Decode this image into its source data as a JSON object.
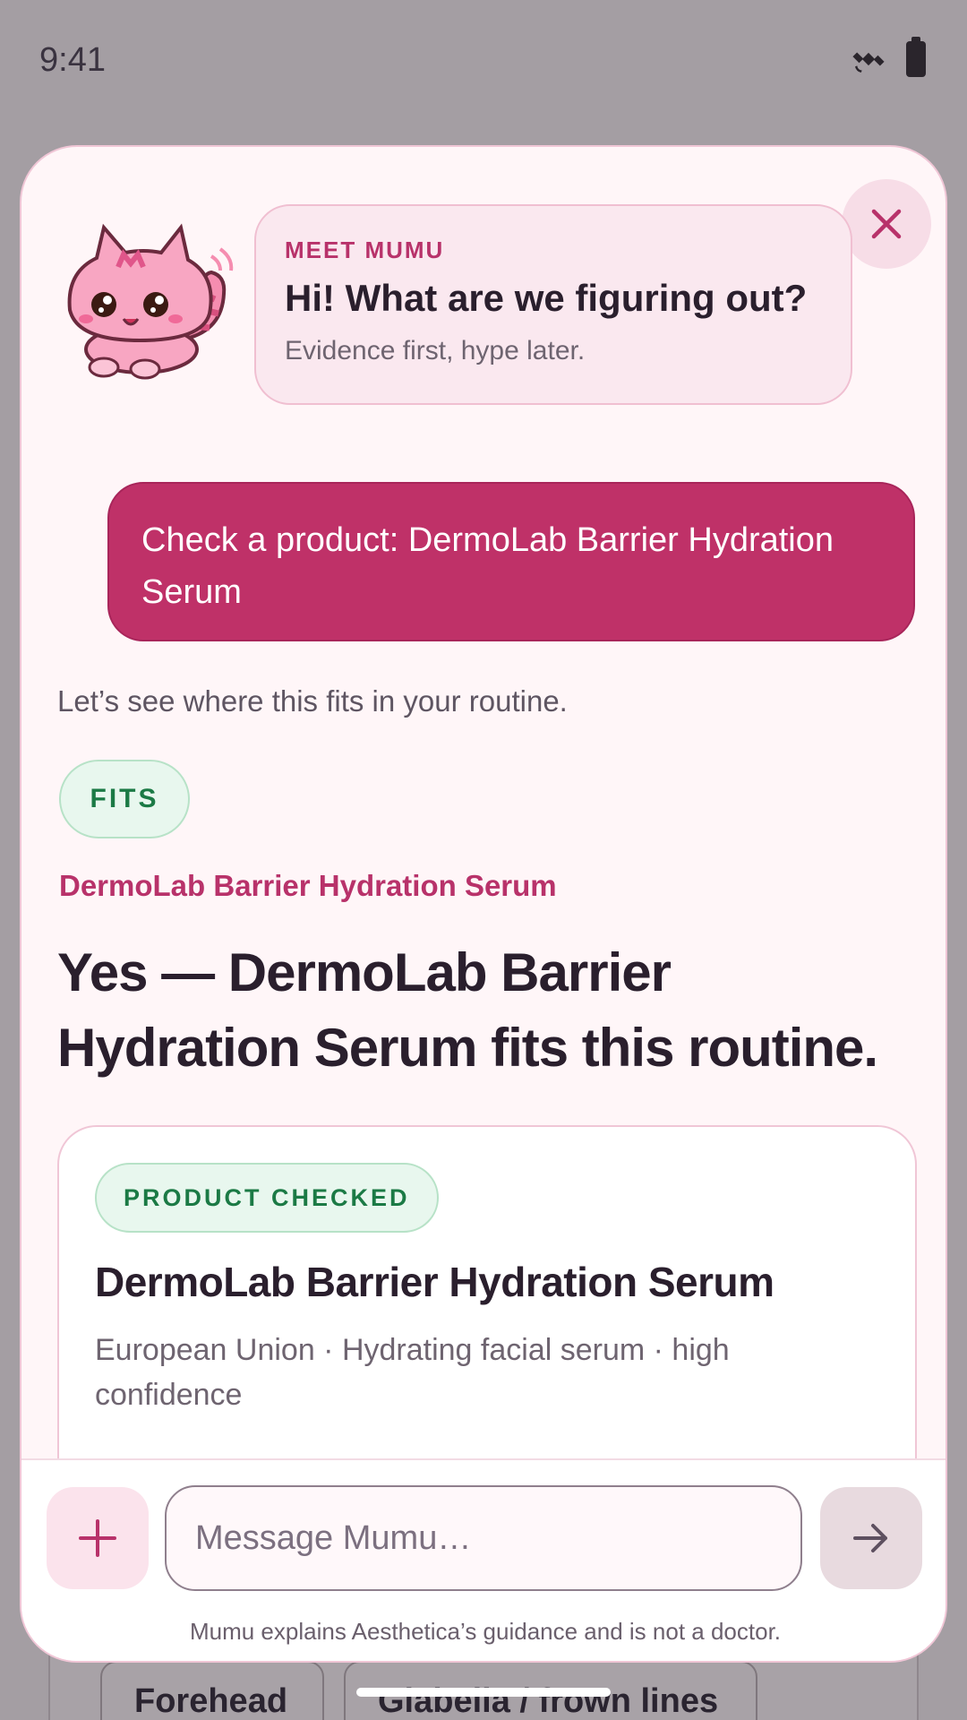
{
  "status_bar": {
    "time": "9:41",
    "icons": [
      "satellite-icon",
      "battery-icon"
    ]
  },
  "intro": {
    "eyebrow": "MEET MUMU",
    "title": "Hi! What are we figuring out?",
    "subtitle": "Evidence first, hype later."
  },
  "conversation": {
    "user_message": "Check a product: DermoLab Barrier Hydration Serum",
    "assistant_note": "Let’s see where this fits in your routine.",
    "badge": "FITS",
    "product_name": "DermoLab Barrier Hydration Serum",
    "verdict": "Yes — DermoLab Barrier Hydration Serum fits this routine."
  },
  "product_card": {
    "badge": "PRODUCT CHECKED",
    "title": "DermoLab Barrier Hydration Serum",
    "meta": "European Union · Hydrating facial serum · high confidence"
  },
  "composer": {
    "placeholder": "Message Mumu…",
    "disclaimer": "Mumu explains Aesthetica’s guidance and is not a doctor."
  },
  "background": {
    "chips": [
      "Forehead",
      "Glabella / frown lines"
    ]
  },
  "colors": {
    "accent": "#bf3168",
    "success": "#1b7a45",
    "sheet": "#fff6f8"
  }
}
